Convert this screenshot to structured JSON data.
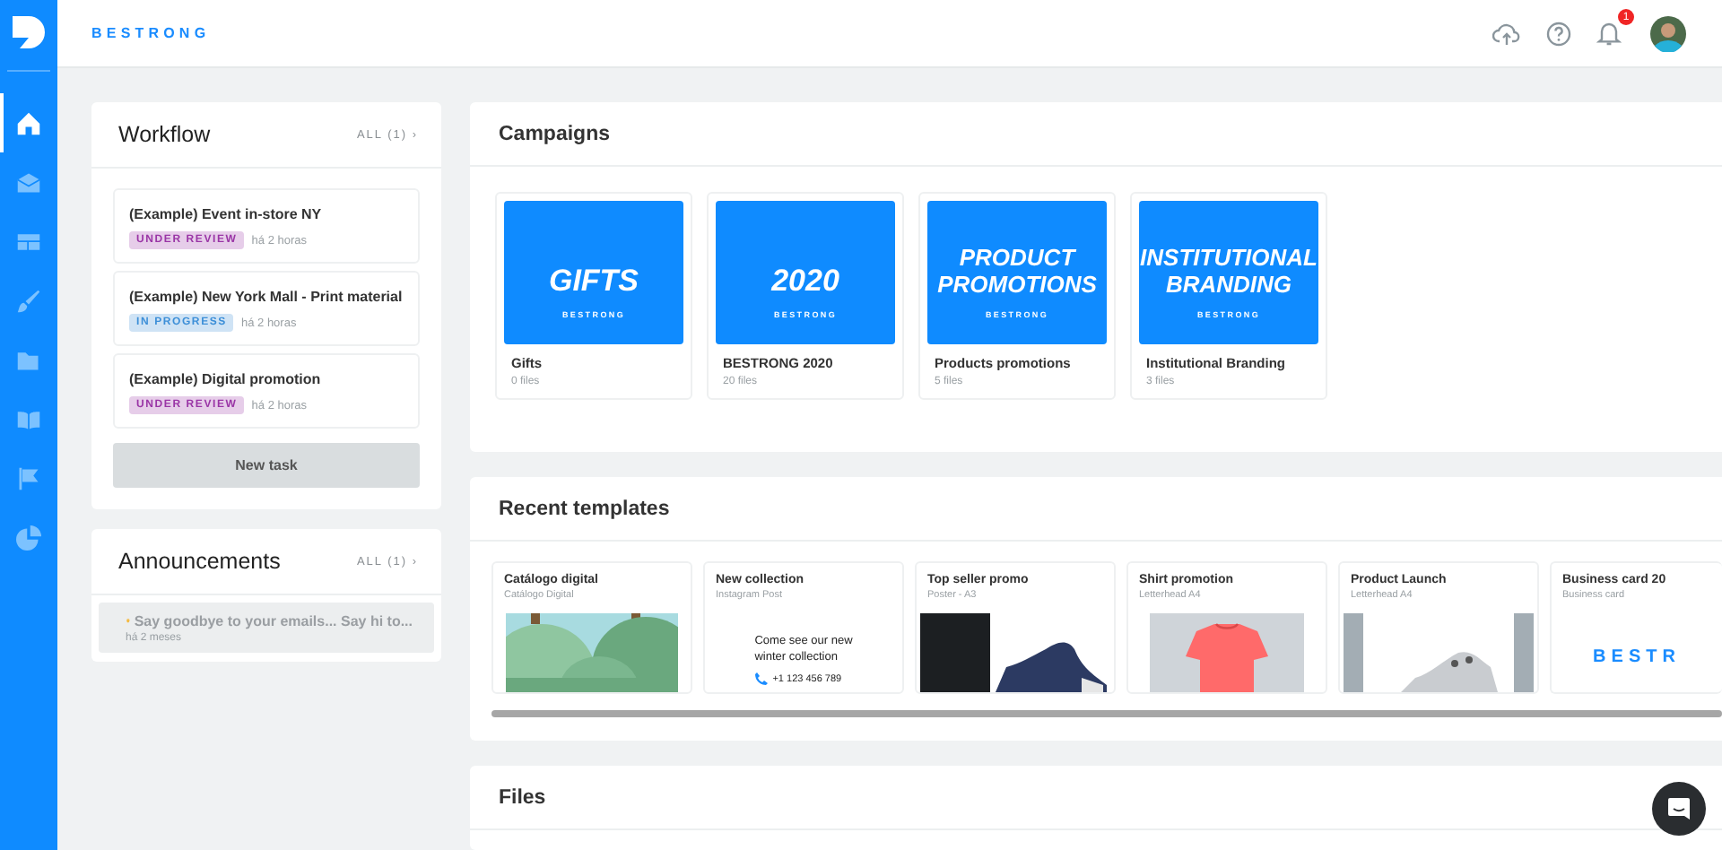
{
  "header": {
    "brand": "BESTRONG",
    "notification_count": "1"
  },
  "nav": [
    {
      "kind": "home",
      "selected": true
    },
    {
      "kind": "mail",
      "selected": false
    },
    {
      "kind": "layout",
      "selected": false
    },
    {
      "kind": "brush",
      "selected": false
    },
    {
      "kind": "folder",
      "selected": false
    },
    {
      "kind": "book",
      "selected": false
    },
    {
      "kind": "flag",
      "selected": false
    },
    {
      "kind": "pie",
      "selected": false
    }
  ],
  "workflow": {
    "title": "Workflow",
    "all_link": "ALL (1) ›",
    "tasks": [
      {
        "title": "(Example) Event in-store NY",
        "status": "UNDER REVIEW",
        "color": "#9a35a6",
        "time": "há 2 horas"
      },
      {
        "title": "(Example) New York Mall - Print material",
        "status": "IN PROGRESS",
        "color": "#3d8fd8",
        "time": "há 2 horas"
      },
      {
        "title": "(Example) Digital promotion",
        "status": "UNDER REVIEW",
        "color": "#9a35a6",
        "time": "há 2 horas"
      }
    ],
    "button": "New task"
  },
  "announcements": {
    "title": "Announcements",
    "all_link": "ALL (1) ›",
    "items": [
      {
        "text": "Say goodbye to your emails... Say hi to...",
        "time": "há 2 meses"
      }
    ]
  },
  "campaigns": {
    "title": "Campaigns",
    "items": [
      {
        "cover_lines": [
          "GIFTS"
        ],
        "cover_brand": "BESTRONG",
        "name": "Gifts",
        "files": "0 files"
      },
      {
        "cover_lines": [
          "2020"
        ],
        "cover_brand": "BESTRONG",
        "name": "BESTRONG 2020",
        "files": "20 files"
      },
      {
        "cover_lines": [
          "PRODUCT",
          "PROMOTIONS"
        ],
        "cover_brand": "BESTRONG",
        "name": "Products promotions",
        "files": "5 files"
      },
      {
        "cover_lines": [
          "INSTITUTIONAL",
          "BRANDING"
        ],
        "cover_brand": "BESTRONG",
        "name": "Institutional Branding",
        "files": "3 files"
      }
    ]
  },
  "templates": {
    "title": "Recent templates",
    "items": [
      {
        "name": "Catálogo digital",
        "type": "Catálogo Digital",
        "preview": {
          "kind": "forest"
        }
      },
      {
        "name": "New collection",
        "type": "Instagram Post",
        "preview": {
          "kind": "text",
          "lines": [
            "Come see our new",
            "winter collection"
          ],
          "phone": "+1 123 456 789"
        }
      },
      {
        "name": "Top seller promo",
        "type": "Poster - A3",
        "preview": {
          "kind": "shoe"
        }
      },
      {
        "name": "Shirt promotion",
        "type": "Letterhead A4",
        "preview": {
          "kind": "shirt"
        }
      },
      {
        "name": "Product Launch",
        "type": "Letterhead A4",
        "preview": {
          "kind": "sneaker"
        }
      },
      {
        "name": "Business card 20",
        "type": "Business card",
        "preview": {
          "kind": "logo",
          "text": "BESTR"
        }
      }
    ]
  },
  "files": {
    "title": "Files"
  }
}
